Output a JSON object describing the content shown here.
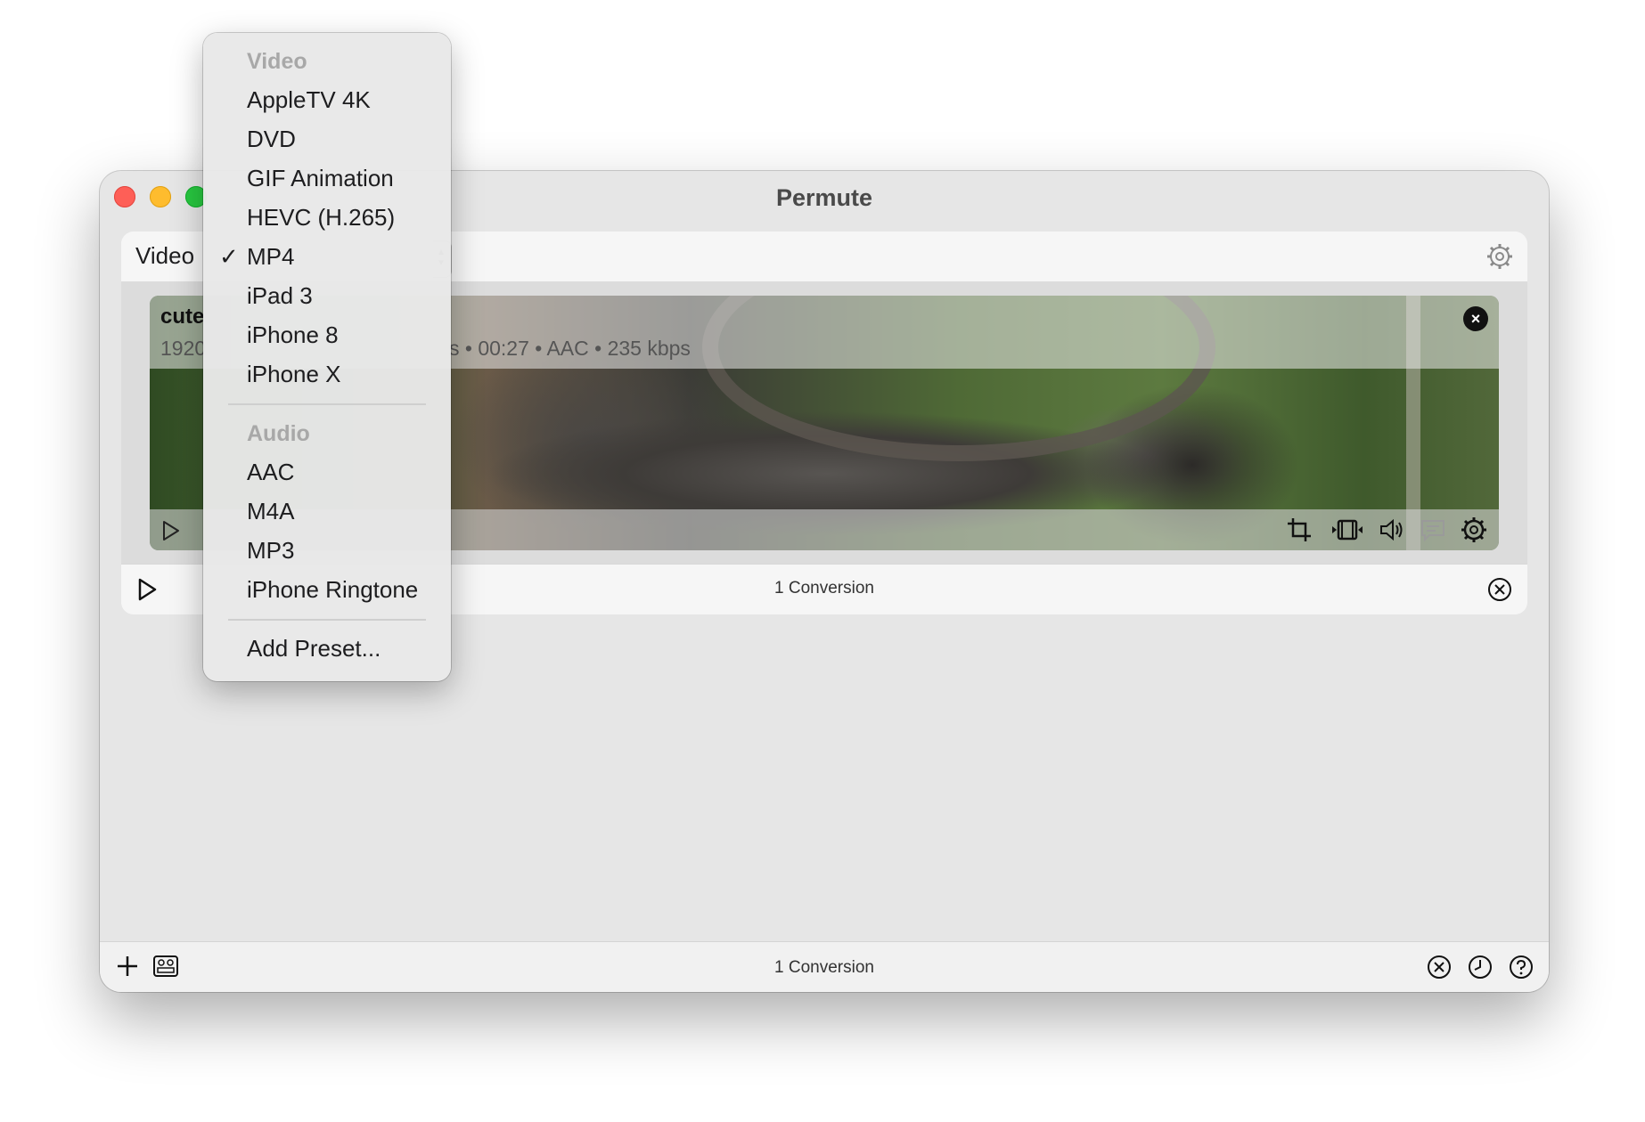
{
  "window": {
    "title": "Permute"
  },
  "toolbar": {
    "preset_category": "Video"
  },
  "item": {
    "name": "cute",
    "meta_left": "1920",
    "meta_right": "s • 00:27 • AAC • 235 kbps"
  },
  "queue": {
    "count_label": "1 Conversion"
  },
  "bottom_bar": {
    "count_label": "1 Conversion"
  },
  "menu": {
    "video_header": "Video",
    "video_items": [
      "AppleTV 4K",
      "DVD",
      "GIF Animation",
      "HEVC (H.265)",
      "MP4",
      "iPad 3",
      "iPhone 8",
      "iPhone X"
    ],
    "selected": "MP4",
    "check_mark": "✓",
    "audio_header": "Audio",
    "audio_items": [
      "AAC",
      "M4A",
      "MP3",
      "iPhone Ringtone"
    ],
    "add_preset": "Add Preset..."
  },
  "icons": {
    "close_badge": "×"
  }
}
